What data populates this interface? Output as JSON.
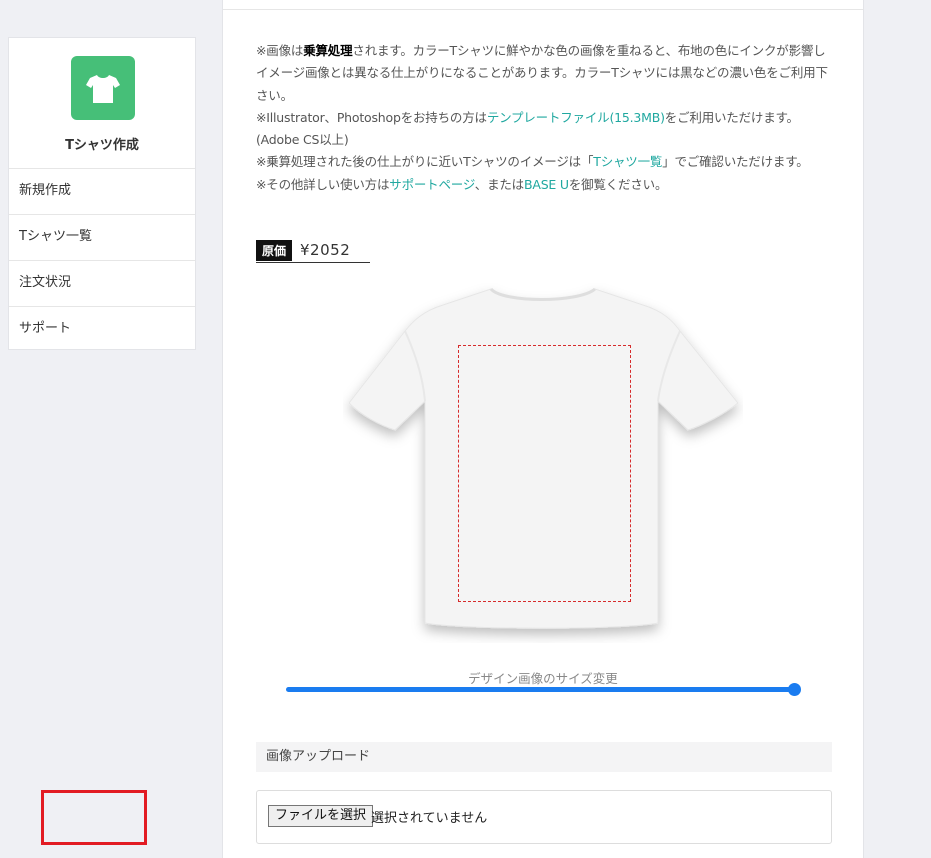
{
  "sidebar": {
    "brand_icon": "tshirt-icon",
    "brand_title": "Tシャツ作成",
    "items": [
      {
        "label": "新規作成"
      },
      {
        "label": "Tシャツ一覧"
      },
      {
        "label": "注文状況"
      },
      {
        "label": "サポート"
      }
    ]
  },
  "notes": {
    "line1_pre": "※画像は",
    "line1_bold": "乗算処理",
    "line1_post": "されます。カラーTシャツに鮮やかな色の画像を重ねると、布地の色にインクが影響しイメージ画像とは異なる仕上がりになることがあります。カラーTシャツには黒などの濃い色をご利用下さい。",
    "line2_pre": "※Illustrator、Photoshopをお持ちの方は",
    "line2_link": "テンプレートファイル(15.3MB)",
    "line2_post": "をご利用いただけます。(Adobe CS以上)",
    "line3_pre": "※乗算処理された後の仕上がりに近いTシャツのイメージは「",
    "line3_link": "Tシャツ一覧",
    "line3_post": "」でご確認いただけます。",
    "line4_pre": "※その他詳しい使い方は",
    "line4_link1": "サポートページ",
    "line4_mid": "、または",
    "line4_link2": "BASE U",
    "line4_post": "を御覧ください。"
  },
  "price": {
    "label": "原価",
    "value": "¥2052"
  },
  "preview": {
    "image": "white-tshirt-image"
  },
  "slider": {
    "label": "デザイン画像のサイズ変更",
    "value_fraction": 1.0,
    "color": "#1a7cf0"
  },
  "upload": {
    "section_title": "画像アップロード",
    "button_label": "ファイルを選択",
    "status_text": "選択されていません"
  },
  "colors": {
    "brand": "#46bf78",
    "link": "#20a8a0",
    "highlight": "#e21b23"
  }
}
